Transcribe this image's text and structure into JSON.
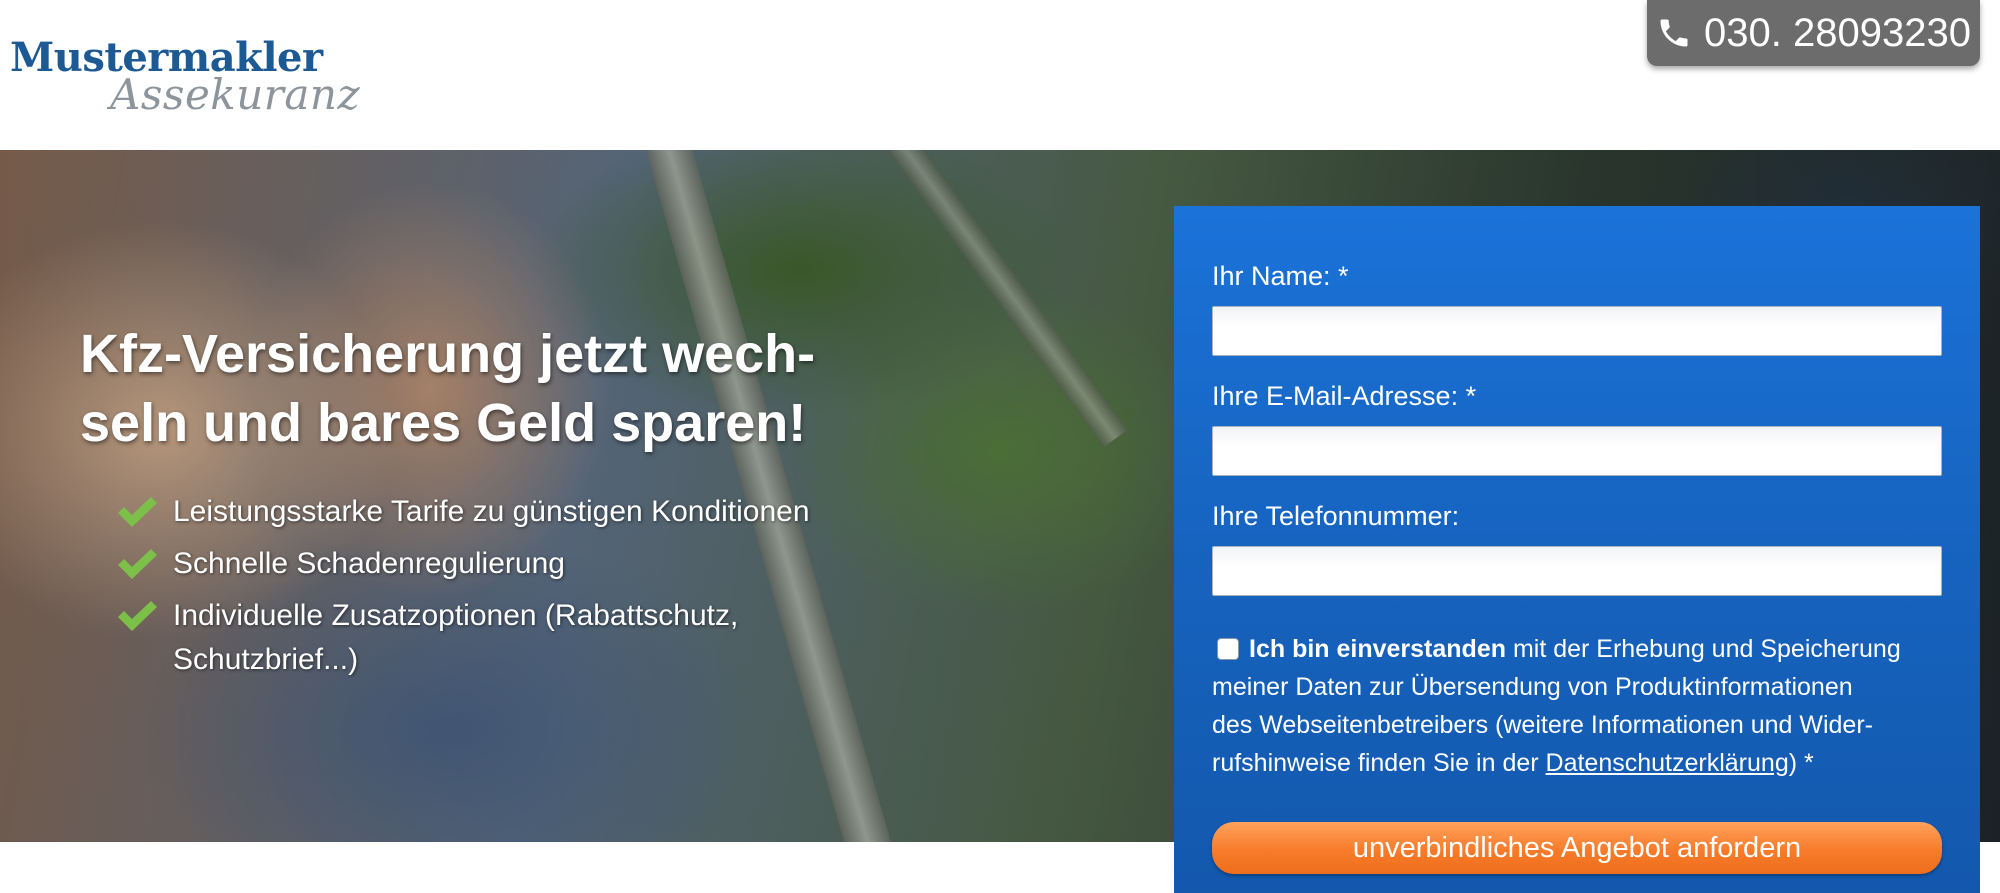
{
  "header": {
    "logo_top": "Mustermakler",
    "logo_bottom": "Assekuranz",
    "phone": "030. 28093230"
  },
  "hero": {
    "title_line1": "Kfz-Versicherung jetzt wech-",
    "title_line2": "seln und bares Geld sparen!",
    "features": [
      {
        "lines": [
          "Leistungsstarke Tarife zu günstigen Konditionen"
        ]
      },
      {
        "lines": [
          "Schnelle Schadenregulierung"
        ]
      },
      {
        "lines": [
          "Individuelle Zusatzoptionen (Rabattschutz,",
          "Schutzbrief...)"
        ]
      }
    ]
  },
  "form": {
    "name_label": "Ihr Name: *",
    "name_value": "",
    "email_label": "Ihre E-Mail-Adresse: *",
    "email_value": "",
    "phone_label": "Ihre Telefonnummer:",
    "phone_value": "",
    "consent": {
      "checked": false,
      "bold": "Ich bin einverstanden",
      "line1_rest": " mit der Erhebung und Speicherung",
      "line2": "meiner Daten zur Übersendung von Produktinformationen",
      "line3": "des Webseitenbetreibers (weitere Informationen und Wider-",
      "line4_before": "rufshinweise finden Sie in der ",
      "link": "Datenschutzerklärung",
      "line4_after": ") *"
    },
    "submit_label": "unverbindliches Angebot anfordern"
  },
  "colors": {
    "form_blue": "#1b72d8",
    "submit_orange": "#f77b2a",
    "check_green": "#7cc04a",
    "logo_blue": "#1d5a93",
    "phone_bg": "#6c6c6c"
  },
  "icons": [
    "phone-icon",
    "check-icon"
  ]
}
